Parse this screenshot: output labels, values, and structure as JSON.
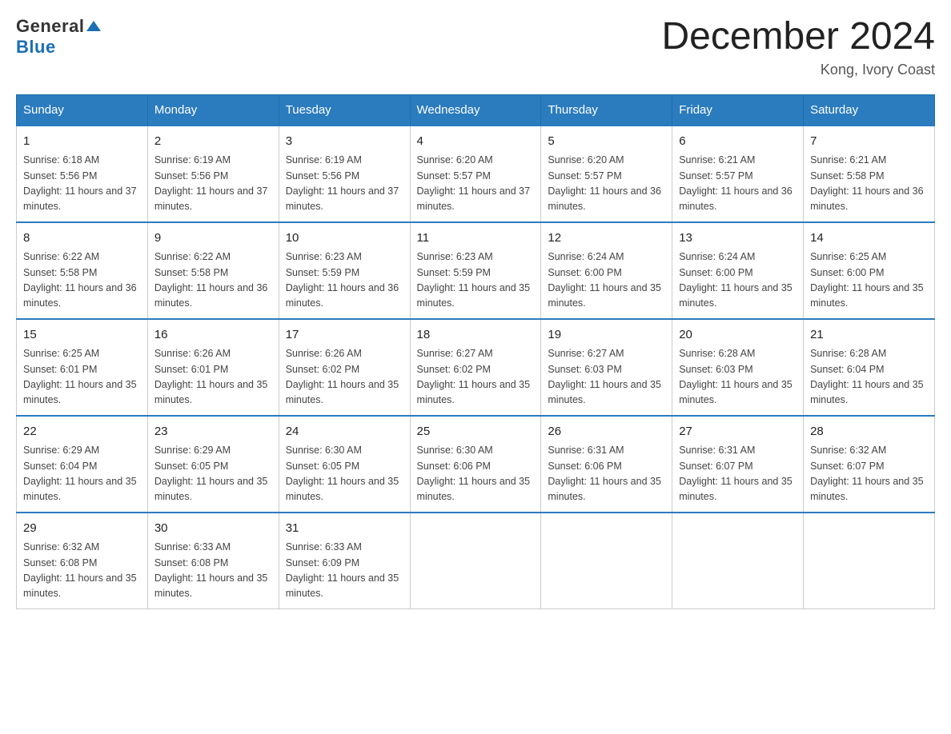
{
  "logo": {
    "general": "General",
    "blue": "Blue"
  },
  "title": "December 2024",
  "location": "Kong, Ivory Coast",
  "days_of_week": [
    "Sunday",
    "Monday",
    "Tuesday",
    "Wednesday",
    "Thursday",
    "Friday",
    "Saturday"
  ],
  "weeks": [
    [
      {
        "day": "1",
        "sunrise": "6:18 AM",
        "sunset": "5:56 PM",
        "daylight": "11 hours and 37 minutes."
      },
      {
        "day": "2",
        "sunrise": "6:19 AM",
        "sunset": "5:56 PM",
        "daylight": "11 hours and 37 minutes."
      },
      {
        "day": "3",
        "sunrise": "6:19 AM",
        "sunset": "5:56 PM",
        "daylight": "11 hours and 37 minutes."
      },
      {
        "day": "4",
        "sunrise": "6:20 AM",
        "sunset": "5:57 PM",
        "daylight": "11 hours and 37 minutes."
      },
      {
        "day": "5",
        "sunrise": "6:20 AM",
        "sunset": "5:57 PM",
        "daylight": "11 hours and 36 minutes."
      },
      {
        "day": "6",
        "sunrise": "6:21 AM",
        "sunset": "5:57 PM",
        "daylight": "11 hours and 36 minutes."
      },
      {
        "day": "7",
        "sunrise": "6:21 AM",
        "sunset": "5:58 PM",
        "daylight": "11 hours and 36 minutes."
      }
    ],
    [
      {
        "day": "8",
        "sunrise": "6:22 AM",
        "sunset": "5:58 PM",
        "daylight": "11 hours and 36 minutes."
      },
      {
        "day": "9",
        "sunrise": "6:22 AM",
        "sunset": "5:58 PM",
        "daylight": "11 hours and 36 minutes."
      },
      {
        "day": "10",
        "sunrise": "6:23 AM",
        "sunset": "5:59 PM",
        "daylight": "11 hours and 36 minutes."
      },
      {
        "day": "11",
        "sunrise": "6:23 AM",
        "sunset": "5:59 PM",
        "daylight": "11 hours and 35 minutes."
      },
      {
        "day": "12",
        "sunrise": "6:24 AM",
        "sunset": "6:00 PM",
        "daylight": "11 hours and 35 minutes."
      },
      {
        "day": "13",
        "sunrise": "6:24 AM",
        "sunset": "6:00 PM",
        "daylight": "11 hours and 35 minutes."
      },
      {
        "day": "14",
        "sunrise": "6:25 AM",
        "sunset": "6:00 PM",
        "daylight": "11 hours and 35 minutes."
      }
    ],
    [
      {
        "day": "15",
        "sunrise": "6:25 AM",
        "sunset": "6:01 PM",
        "daylight": "11 hours and 35 minutes."
      },
      {
        "day": "16",
        "sunrise": "6:26 AM",
        "sunset": "6:01 PM",
        "daylight": "11 hours and 35 minutes."
      },
      {
        "day": "17",
        "sunrise": "6:26 AM",
        "sunset": "6:02 PM",
        "daylight": "11 hours and 35 minutes."
      },
      {
        "day": "18",
        "sunrise": "6:27 AM",
        "sunset": "6:02 PM",
        "daylight": "11 hours and 35 minutes."
      },
      {
        "day": "19",
        "sunrise": "6:27 AM",
        "sunset": "6:03 PM",
        "daylight": "11 hours and 35 minutes."
      },
      {
        "day": "20",
        "sunrise": "6:28 AM",
        "sunset": "6:03 PM",
        "daylight": "11 hours and 35 minutes."
      },
      {
        "day": "21",
        "sunrise": "6:28 AM",
        "sunset": "6:04 PM",
        "daylight": "11 hours and 35 minutes."
      }
    ],
    [
      {
        "day": "22",
        "sunrise": "6:29 AM",
        "sunset": "6:04 PM",
        "daylight": "11 hours and 35 minutes."
      },
      {
        "day": "23",
        "sunrise": "6:29 AM",
        "sunset": "6:05 PM",
        "daylight": "11 hours and 35 minutes."
      },
      {
        "day": "24",
        "sunrise": "6:30 AM",
        "sunset": "6:05 PM",
        "daylight": "11 hours and 35 minutes."
      },
      {
        "day": "25",
        "sunrise": "6:30 AM",
        "sunset": "6:06 PM",
        "daylight": "11 hours and 35 minutes."
      },
      {
        "day": "26",
        "sunrise": "6:31 AM",
        "sunset": "6:06 PM",
        "daylight": "11 hours and 35 minutes."
      },
      {
        "day": "27",
        "sunrise": "6:31 AM",
        "sunset": "6:07 PM",
        "daylight": "11 hours and 35 minutes."
      },
      {
        "day": "28",
        "sunrise": "6:32 AM",
        "sunset": "6:07 PM",
        "daylight": "11 hours and 35 minutes."
      }
    ],
    [
      {
        "day": "29",
        "sunrise": "6:32 AM",
        "sunset": "6:08 PM",
        "daylight": "11 hours and 35 minutes."
      },
      {
        "day": "30",
        "sunrise": "6:33 AM",
        "sunset": "6:08 PM",
        "daylight": "11 hours and 35 minutes."
      },
      {
        "day": "31",
        "sunrise": "6:33 AM",
        "sunset": "6:09 PM",
        "daylight": "11 hours and 35 minutes."
      },
      null,
      null,
      null,
      null
    ]
  ],
  "labels": {
    "sunrise": "Sunrise:",
    "sunset": "Sunset:",
    "daylight": "Daylight:"
  }
}
